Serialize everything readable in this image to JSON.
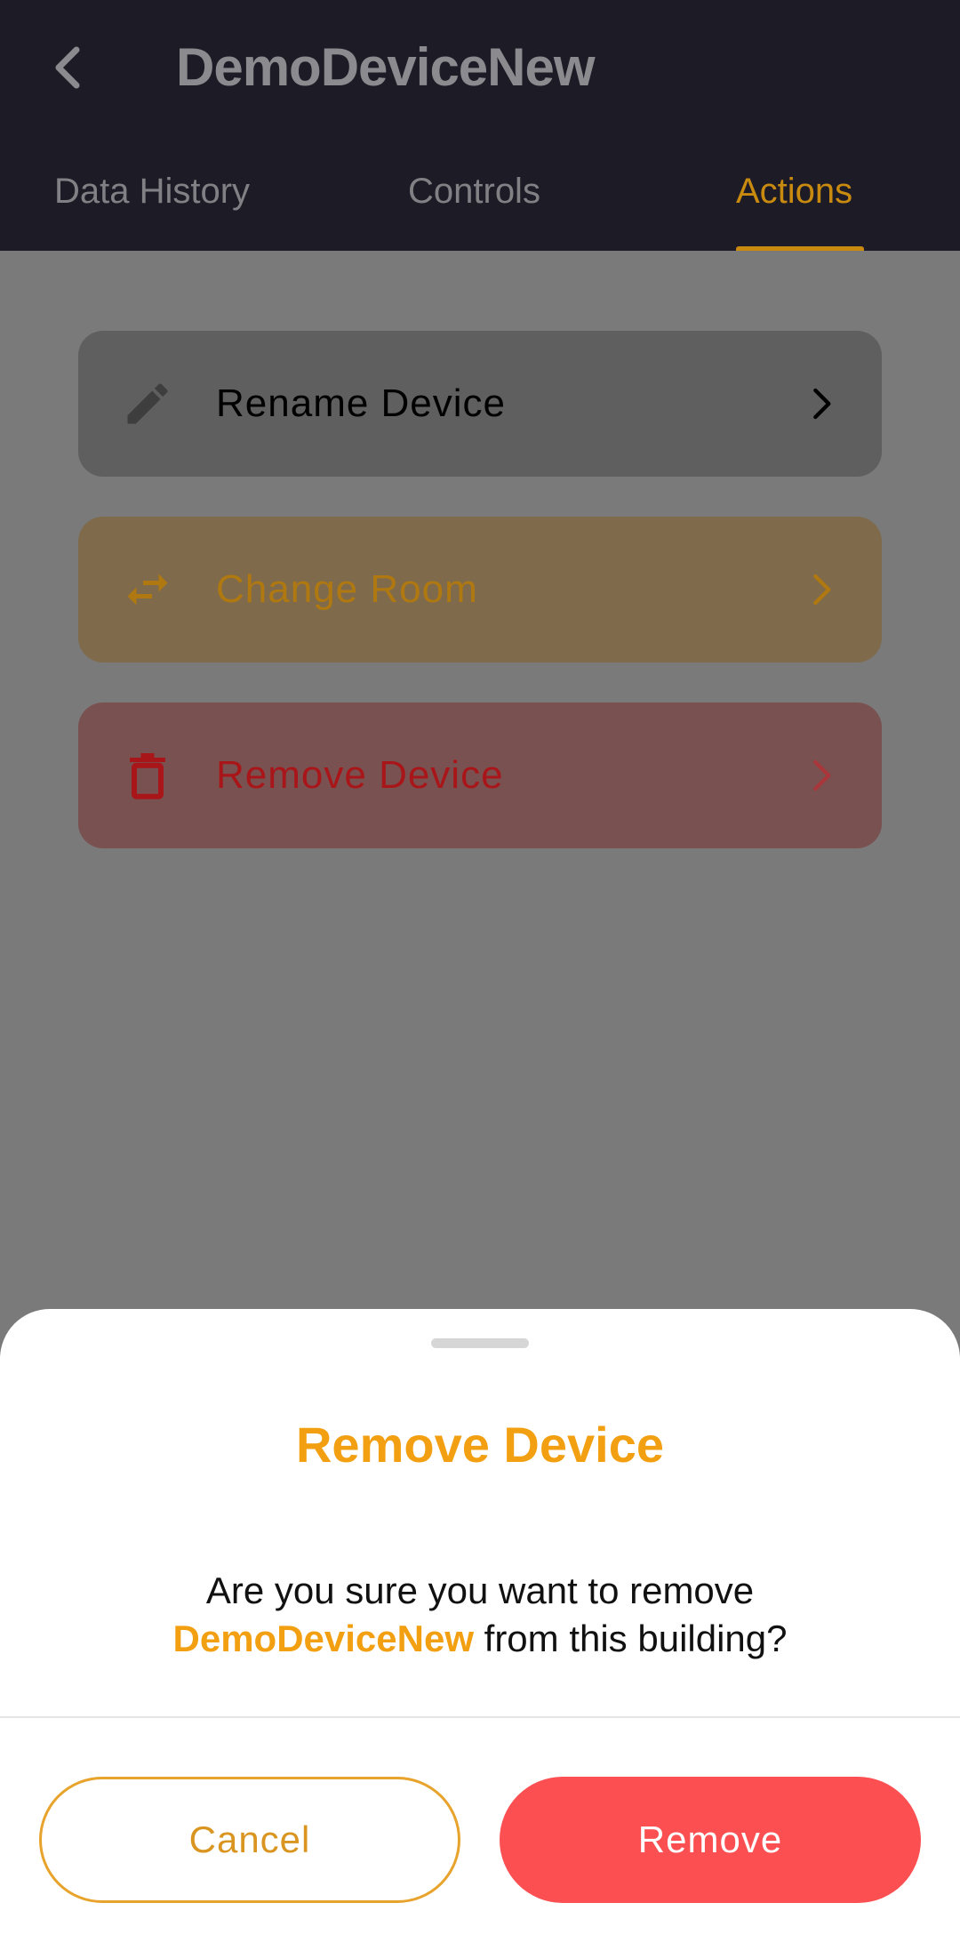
{
  "header": {
    "title": "DemoDeviceNew",
    "tabs": [
      {
        "label": "Data History",
        "active": false
      },
      {
        "label": "Controls",
        "active": false
      },
      {
        "label": "Actions",
        "active": true
      }
    ]
  },
  "actions": [
    {
      "label": "Rename Device",
      "icon": "pencil-icon",
      "color": "#000000"
    },
    {
      "label": "Change Room",
      "icon": "swap-icon",
      "color": "#c98a10"
    },
    {
      "label": "Remove Device",
      "icon": "trash-icon",
      "color": "#c4141a"
    }
  ],
  "dialog": {
    "title": "Remove Device",
    "message_prefix": "Are you sure you want to remove",
    "device_name": "DemoDeviceNew",
    "message_suffix": " from this building?",
    "cancel_label": "Cancel",
    "confirm_label": "Remove"
  },
  "colors": {
    "accent": "#f29f11",
    "danger": "#fb4f52",
    "header_bg": "#1d1c26"
  }
}
